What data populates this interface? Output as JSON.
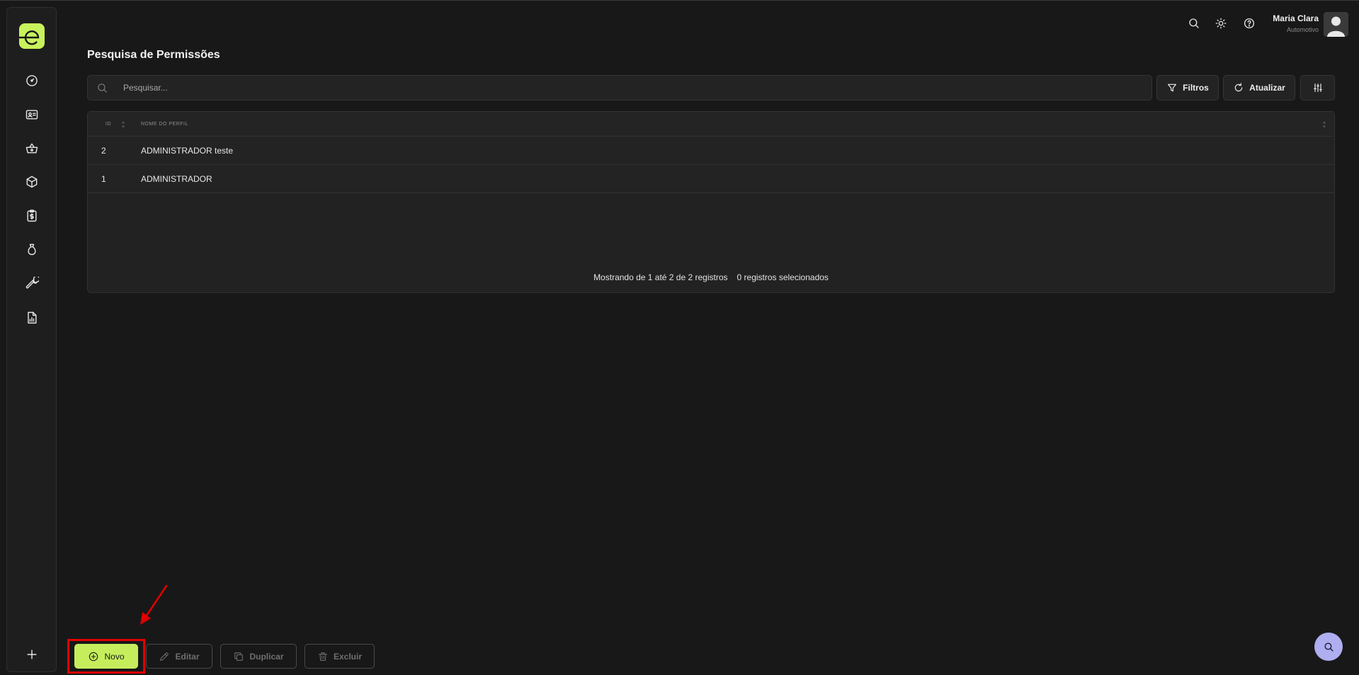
{
  "page": {
    "title": "Pesquisa de Permissões"
  },
  "header": {
    "user_name": "Maria Clara",
    "user_subtitle": "Automotivo",
    "icons": [
      "search-icon",
      "sun-icon",
      "help-icon"
    ]
  },
  "sidebar": {
    "logo_letter": "e",
    "items": [
      {
        "icon": "dashboard-gauge-icon"
      },
      {
        "icon": "id-card-icon"
      },
      {
        "icon": "basket-icon"
      },
      {
        "icon": "box-icon"
      },
      {
        "icon": "clipboard-dollar-icon"
      },
      {
        "icon": "money-bag-icon"
      },
      {
        "icon": "wrench-icon"
      },
      {
        "icon": "report-chart-icon"
      }
    ],
    "add_icon": "plus-icon"
  },
  "search": {
    "placeholder": "Pesquisar..."
  },
  "toolbar": {
    "filters_label": "Filtros",
    "refresh_label": "Atualizar"
  },
  "table": {
    "columns": [
      "ID",
      "NOME DO PERFIL"
    ],
    "rows": [
      {
        "id": "2",
        "name": "ADMINISTRADOR teste"
      },
      {
        "id": "1",
        "name": "ADMINISTRADOR"
      }
    ],
    "footer_count": "Mostrando de 1 até 2 de 2 registros",
    "footer_selected": "0 registros selecionados"
  },
  "actions": {
    "new_label": "Novo",
    "edit_label": "Editar",
    "duplicate_label": "Duplicar",
    "delete_label": "Excluir"
  },
  "colors": {
    "accent": "#c6ee5c",
    "background": "#181818",
    "fab": "#aeaef0",
    "annotation": "#e00000"
  }
}
